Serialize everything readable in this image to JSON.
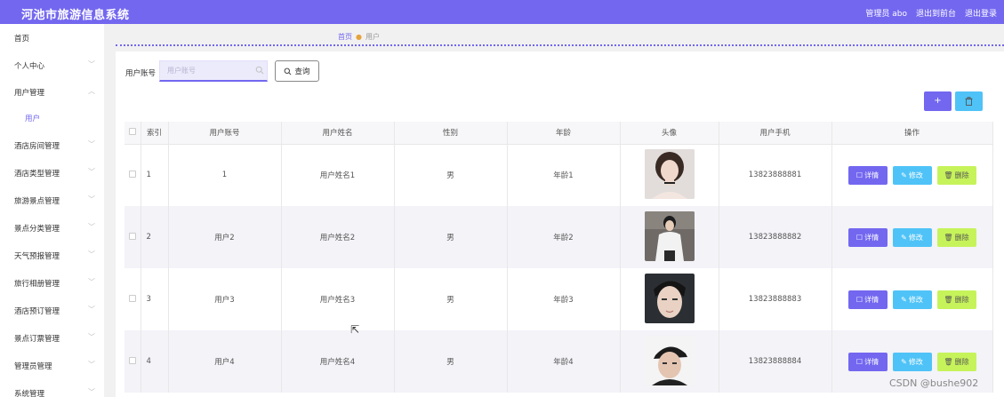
{
  "header": {
    "app_title": "河池市旅游信息系统",
    "admin_label": "管理员 abo",
    "back_frontend": "退出到前台",
    "logout": "退出登录",
    "bar_color": "#7367f0"
  },
  "sidebar": {
    "items": [
      {
        "label": "首页",
        "has_arrow": false
      },
      {
        "label": "个人中心",
        "has_arrow": true
      },
      {
        "label": "用户管理",
        "has_arrow": true
      },
      {
        "label": "用户",
        "sub": true
      },
      {
        "label": "酒店房间管理",
        "has_arrow": true
      },
      {
        "label": "酒店类型管理",
        "has_arrow": true
      },
      {
        "label": "旅游景点管理",
        "has_arrow": true
      },
      {
        "label": "景点分类管理",
        "has_arrow": true
      },
      {
        "label": "天气预报管理",
        "has_arrow": true
      },
      {
        "label": "旅行相册管理",
        "has_arrow": true
      },
      {
        "label": "酒店预订管理",
        "has_arrow": true
      },
      {
        "label": "景点订票管理",
        "has_arrow": true
      },
      {
        "label": "管理员管理",
        "has_arrow": true
      },
      {
        "label": "系统管理",
        "has_arrow": true
      }
    ]
  },
  "breadcrumb": {
    "home": "首页",
    "current": "用户"
  },
  "search": {
    "label": "用户账号",
    "placeholder": "用户账号",
    "query_label": "查询"
  },
  "toolbar": {
    "add_label": "+"
  },
  "table": {
    "headers": [
      "索引",
      "用户账号",
      "用户姓名",
      "性别",
      "年龄",
      "头像",
      "用户手机",
      "操作"
    ],
    "rows": [
      {
        "index": "1",
        "account": "1",
        "name": "用户姓名1",
        "gender": "男",
        "age": "年龄1",
        "phone": "13823888881",
        "avatar": "avatar-female"
      },
      {
        "index": "2",
        "account": "用户2",
        "name": "用户姓名2",
        "gender": "男",
        "age": "年龄2",
        "phone": "13823888882",
        "avatar": "avatar-male-white-shirt"
      },
      {
        "index": "3",
        "account": "用户3",
        "name": "用户姓名3",
        "gender": "男",
        "age": "年龄3",
        "phone": "13823888883",
        "avatar": "avatar-male-closeup"
      },
      {
        "index": "4",
        "account": "用户4",
        "name": "用户姓名4",
        "gender": "男",
        "age": "年龄4",
        "phone": "13823888884",
        "avatar": "avatar-male-cap"
      }
    ],
    "actions": {
      "detail": "详情",
      "edit": "修改",
      "delete": "删除"
    }
  },
  "watermark": "CSDN @bushe902"
}
